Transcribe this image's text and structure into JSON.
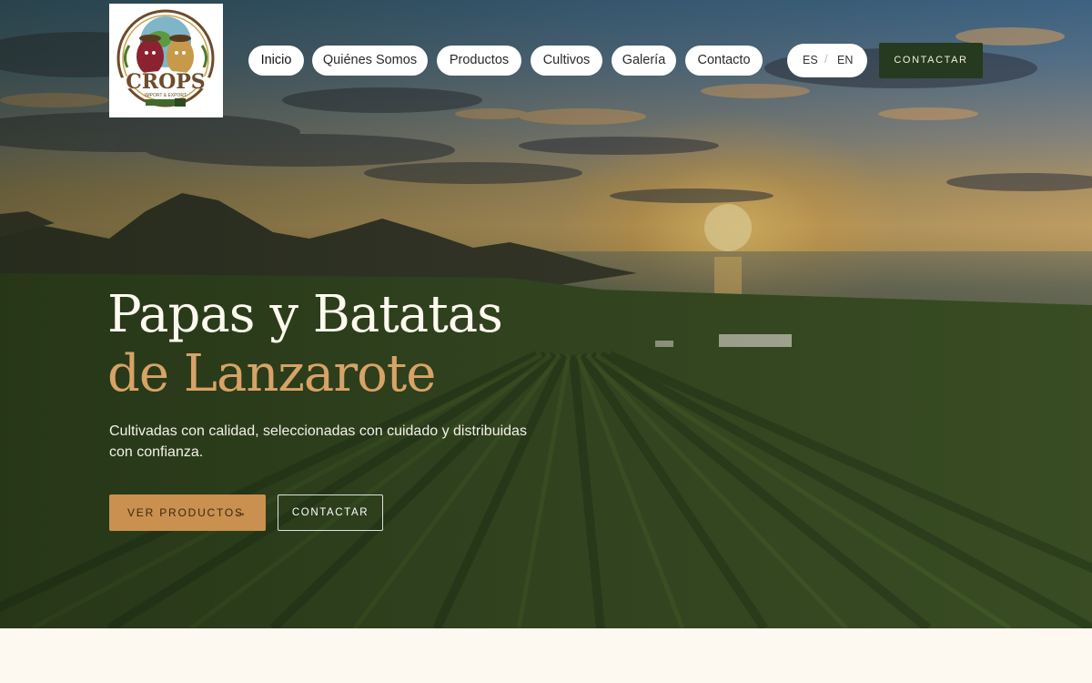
{
  "logo": {
    "brand": "CROPS",
    "tagline": "IMPORT & EXPORT",
    "icon": "crops-logo-potato-mascots"
  },
  "nav": {
    "items": [
      {
        "label": "Inicio",
        "active": true
      },
      {
        "label": "Quiénes Somos"
      },
      {
        "label": "Productos"
      },
      {
        "label": "Cultivos"
      },
      {
        "label": "Galería"
      },
      {
        "label": "Contacto"
      }
    ]
  },
  "language": {
    "es": "ES",
    "separator": "/",
    "en": "EN",
    "selected": "ES"
  },
  "header": {
    "cta_label": "CONTACTAR"
  },
  "hero": {
    "title_line1": "Papas y Batatas",
    "title_line2": "de Lanzarote",
    "subtitle": "Cultivadas con calidad, seleccionadas con cuidado y distribuidas con confianza.",
    "primary_button": "VER PRODUCTOS",
    "primary_button_icon": "arrow-right-icon",
    "secondary_button": "CONTACTAR",
    "background": "sunset-over-potato-fields-volcanoes-sea"
  },
  "colors": {
    "dark_green": "#253a1e",
    "accent_gold": "#d7a366",
    "button_gold": "#c9904f",
    "cream": "#fdf9f1"
  }
}
